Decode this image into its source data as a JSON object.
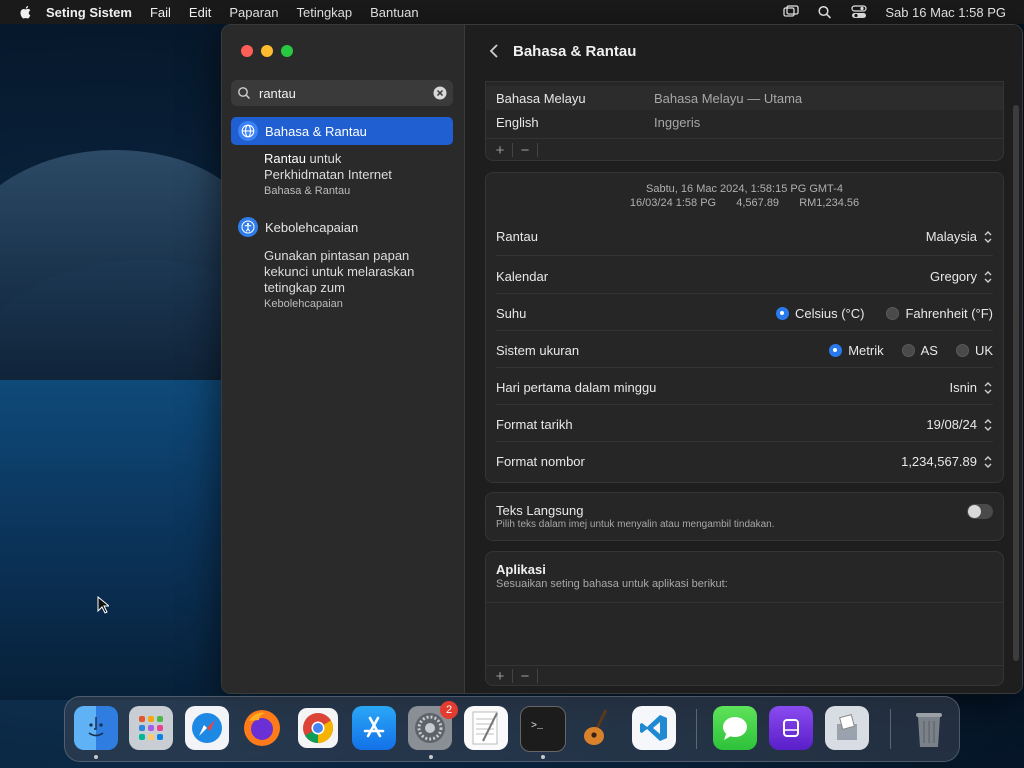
{
  "menubar": {
    "app_name": "Seting Sistem",
    "items": [
      "Fail",
      "Edit",
      "Paparan",
      "Tetingkap",
      "Bantuan"
    ],
    "datetime": "Sab 16 Mac  1:58 PG"
  },
  "sidebar": {
    "search_value": "rantau",
    "selected_label": "Bahasa & Rantau",
    "result1": {
      "title_bold": "Rantau",
      "title_rest": " untuk",
      "line2": "Perkhidmatan Internet",
      "sub": "Bahasa & Rantau"
    },
    "result2_label": "Kebolehcapaian",
    "result3": {
      "line1": "Gunakan pintasan papan",
      "line2": "kekunci untuk melaraskan",
      "line3": "tetingkap zum",
      "sub": "Kebolehcapaian"
    }
  },
  "main": {
    "title": "Bahasa & Rantau",
    "languages": [
      {
        "name": "Bahasa Melayu",
        "desc": "Bahasa Melayu — Utama"
      },
      {
        "name": "English",
        "desc": "Inggeris"
      }
    ],
    "add_label": "+",
    "remove_label": "−",
    "preview_line1": "Sabtu, 16 Mac 2024, 1:58:15 PG GMT-4",
    "preview_line2a": "16/03/24 1:58 PG",
    "preview_line2b": "4,567.89",
    "preview_line2c": "RM1,234.56",
    "region_label": "Rantau",
    "region_value": "Malaysia",
    "calendar_label": "Kalendar",
    "calendar_value": "Gregory",
    "temp_label": "Suhu",
    "temp_celsius": "Celsius (°C)",
    "temp_fahrenheit": "Fahrenheit (°F)",
    "measure_label": "Sistem ukuran",
    "measure_metric": "Metrik",
    "measure_us": "AS",
    "measure_uk": "UK",
    "firstday_label": "Hari pertama dalam minggu",
    "firstday_value": "Isnin",
    "dateformat_label": "Format tarikh",
    "dateformat_value": "19/08/24",
    "numformat_label": "Format nombor",
    "numformat_value": "1,234,567.89",
    "livetext_title": "Teks Langsung",
    "livetext_desc": "Pilih teks dalam imej untuk menyalin atau mengambil tindakan.",
    "apps_title": "Aplikasi",
    "apps_desc": "Sesuaikan seting bahasa untuk aplikasi berikut:"
  },
  "dock": {
    "settings_badge": "2",
    "apps": [
      "finder-icon",
      "launchpad-icon",
      "safari-icon",
      "firefox-icon",
      "chrome-icon",
      "app-store-icon",
      "system-settings-icon",
      "textedit-icon",
      "terminal-icon",
      "garageband-icon",
      "vscode-icon",
      "messages-icon",
      "podcasts-icon",
      "utility-icon",
      "trash-icon"
    ]
  },
  "colors": {
    "accent": "#1f5fd1",
    "radio_on": "#2a7aef"
  }
}
